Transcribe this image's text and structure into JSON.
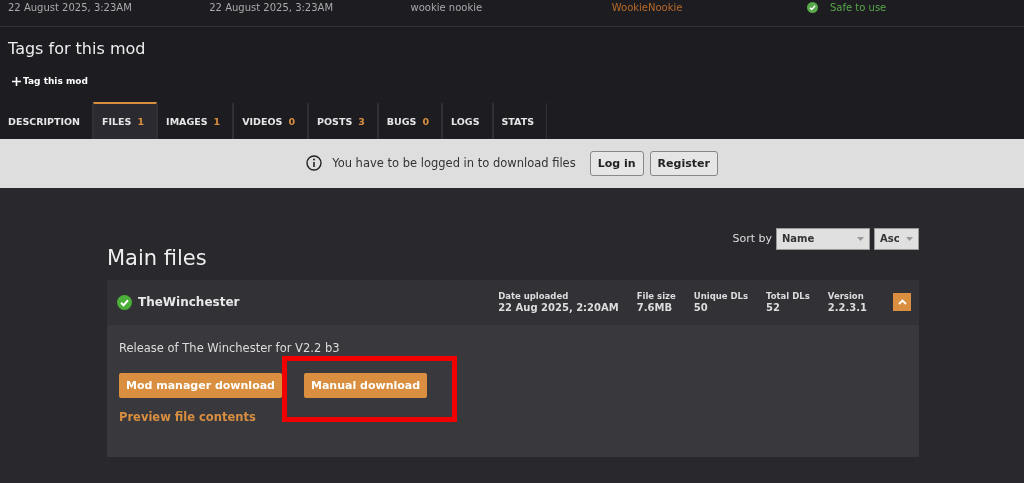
{
  "top_row": [
    "22 August 2025, 3:23AM",
    "22 August 2025, 3:23AM",
    "wookie nookie",
    "WookieNookie"
  ],
  "safety": {
    "label": "Safe to use"
  },
  "tags": {
    "title": "Tags for this mod",
    "add_label": "Tag this mod"
  },
  "tabs": [
    {
      "label": "DESCRIPTION",
      "selected": false
    },
    {
      "label": "FILES",
      "count": "1",
      "selected": true
    },
    {
      "label": "IMAGES",
      "count": "1",
      "selected": false
    },
    {
      "label": "VIDEOS",
      "count": "0",
      "selected": false
    },
    {
      "label": "POSTS",
      "count": "3",
      "selected": false
    },
    {
      "label": "BUGS",
      "count": "0",
      "selected": false
    },
    {
      "label": "LOGS",
      "selected": false
    },
    {
      "label": "STATS",
      "selected": false
    }
  ],
  "notice": {
    "text": "You have to be logged in to download files",
    "buttons": [
      "Log in",
      "Register"
    ]
  },
  "main_files": {
    "title": "Main files",
    "sort_label": "Sort by",
    "sort_field": "Name",
    "sort_order": "Asc"
  },
  "file": {
    "name": "TheWinchester",
    "expanded": true,
    "stats": [
      {
        "label": "Date uploaded",
        "value": "22 Aug 2025, 2:20AM"
      },
      {
        "label": "File size",
        "value": "7.6MB"
      },
      {
        "label": "Unique DLs",
        "value": "50"
      },
      {
        "label": "Total DLs",
        "value": "52"
      },
      {
        "label": "Version",
        "value": "2.2.3.1"
      }
    ],
    "description": "Release of The Winchester for V2.2 b3",
    "buttons": [
      {
        "label": "Mod manager download",
        "highlighted": false
      },
      {
        "label": "Manual download",
        "highlighted": true
      }
    ],
    "preview_link": "Preview file contents"
  }
}
